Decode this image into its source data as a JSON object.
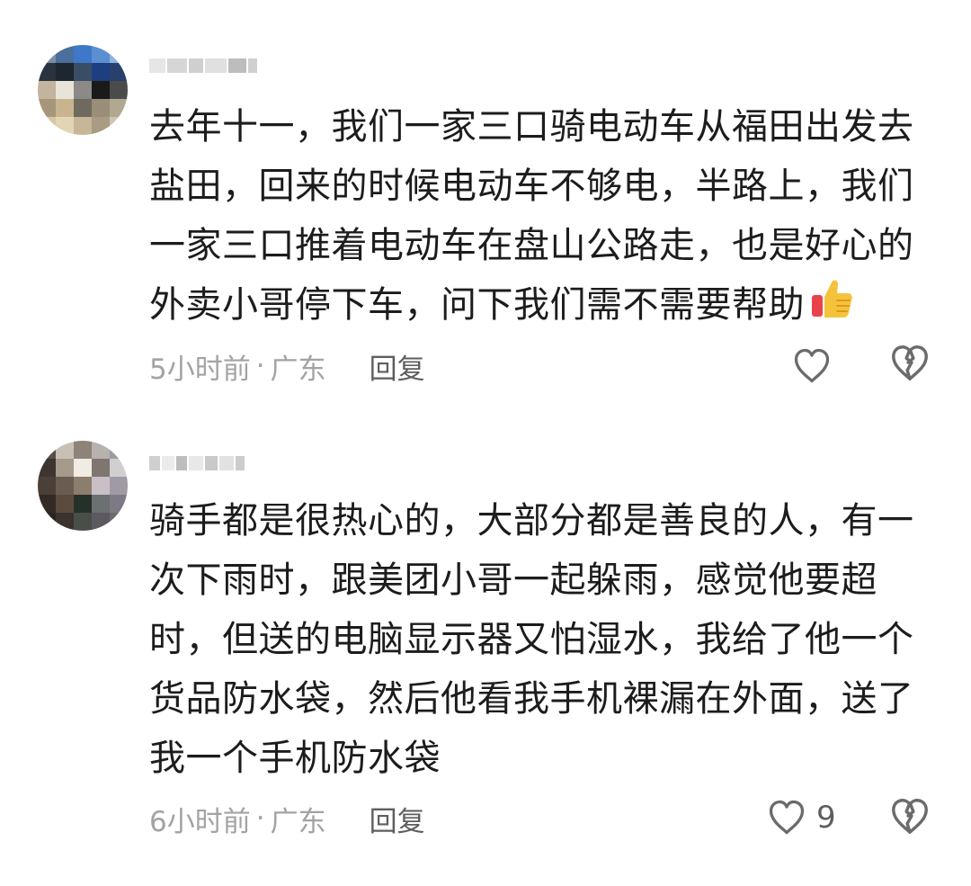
{
  "comments": [
    {
      "text": "去年十一，我们一家三口骑电动车从福田出发去盐田，回来的时候电动车不够电，半路上，我们一家三口推着电动车在盘山公路走，也是好心的外卖小哥停下车，问下我们需不需要帮助",
      "emoji": "thumbs-up-emoji",
      "time": "5小时前",
      "separator": "·",
      "location": "广东",
      "reply_label": "回复",
      "like_count": "",
      "like_icon": "heart-outline-icon",
      "dislike_icon": "broken-heart-icon"
    },
    {
      "text": "骑手都是很热心的，大部分都是善良的人，有一次下雨时，跟美团小哥一起躲雨，感觉他要超时，但送的电脑显示器又怕湿水，我给了他一个货品防水袋，然后他看我手机裸漏在外面，送了我一个手机防水袋",
      "time": "6小时前",
      "separator": "·",
      "location": "广东",
      "reply_label": "回复",
      "like_count": "9",
      "like_icon": "heart-outline-icon",
      "dislike_icon": "broken-heart-icon"
    }
  ],
  "colors": {
    "text": "#1c1c1c",
    "meta": "#a3a3a3",
    "reply": "#5e5e5e",
    "icon": "#6b6b6b"
  }
}
